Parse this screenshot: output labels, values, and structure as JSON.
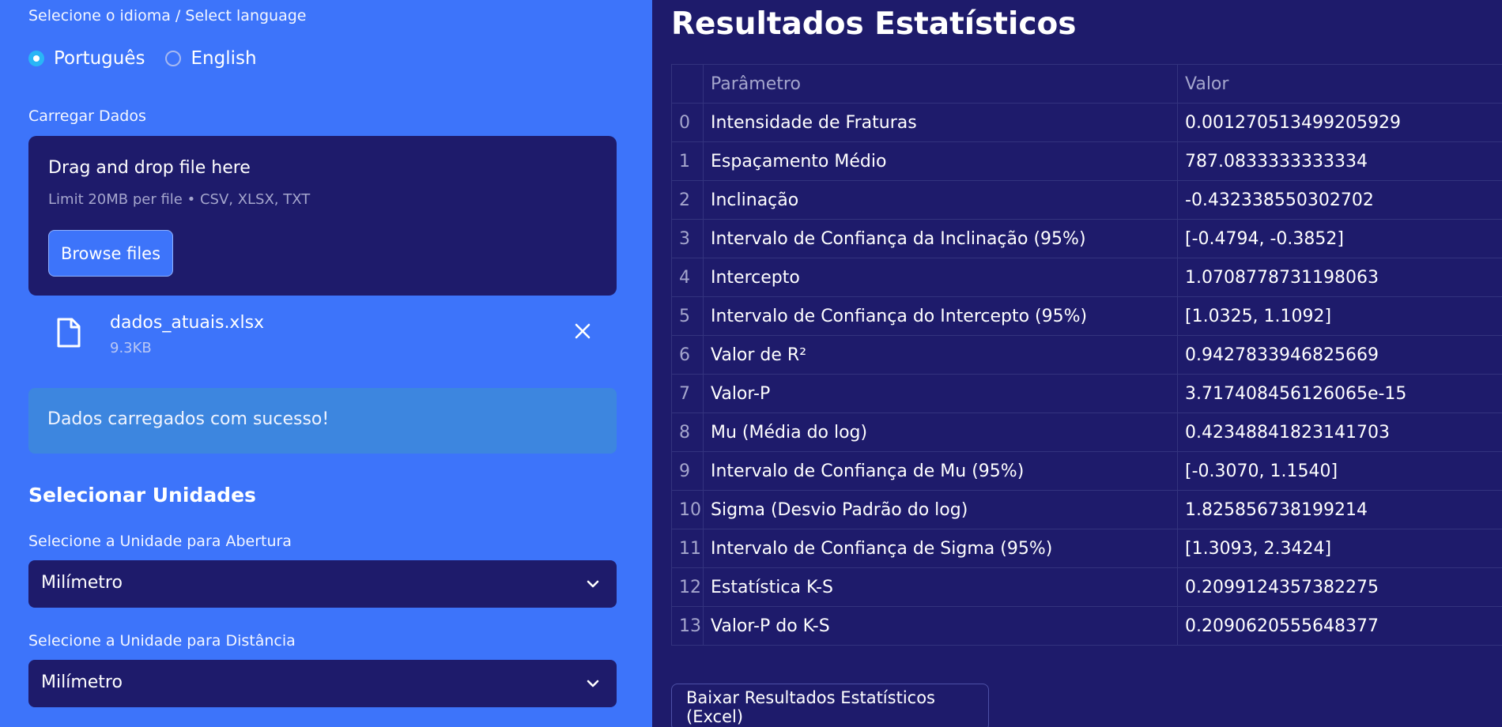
{
  "sidebar": {
    "language_label": "Selecione o idioma / Select language",
    "languages": [
      {
        "label": "Português",
        "selected": true
      },
      {
        "label": "English",
        "selected": false
      }
    ],
    "upload_label": "Carregar Dados",
    "dropzone": {
      "title": "Drag and drop file here",
      "limit": "Limit 20MB per file • CSV, XLSX, TXT",
      "browse_label": "Browse files"
    },
    "uploaded_file": {
      "name": "dados_atuais.xlsx",
      "size": "9.3KB",
      "icon": "file-icon"
    },
    "success_message": "Dados carregados com sucesso!",
    "units_heading": "Selecionar Unidades",
    "aperture_select": {
      "label": "Selecione a Unidade para Abertura",
      "value": "Milímetro"
    },
    "distance_select": {
      "label": "Selecione a Unidade para Distância",
      "value": "Milímetro"
    }
  },
  "main": {
    "title": "Resultados Estatísticos",
    "table": {
      "headers": [
        "",
        "Parâmetro",
        "Valor"
      ],
      "rows": [
        {
          "index": "0",
          "param": "Intensidade de Fraturas",
          "value": "0.001270513499205929"
        },
        {
          "index": "1",
          "param": "Espaçamento Médio",
          "value": "787.0833333333334"
        },
        {
          "index": "2",
          "param": "Inclinação",
          "value": "-0.432338550302702"
        },
        {
          "index": "3",
          "param": "Intervalo de Confiança da Inclinação (95%)",
          "value": "[-0.4794, -0.3852]"
        },
        {
          "index": "4",
          "param": "Intercepto",
          "value": "1.0708778731198063"
        },
        {
          "index": "5",
          "param": "Intervalo de Confiança do Intercepto (95%)",
          "value": "[1.0325, 1.1092]"
        },
        {
          "index": "6",
          "param": "Valor de R²",
          "value": "0.9427833946825669"
        },
        {
          "index": "7",
          "param": "Valor-P",
          "value": "3.717408456126065e-15"
        },
        {
          "index": "8",
          "param": "Mu (Média do log)",
          "value": "0.42348841823141703"
        },
        {
          "index": "9",
          "param": "Intervalo de Confiança de Mu (95%)",
          "value": "[-0.3070, 1.1540]"
        },
        {
          "index": "10",
          "param": "Sigma (Desvio Padrão do log)",
          "value": "1.825856738199214"
        },
        {
          "index": "11",
          "param": "Intervalo de Confiança de Sigma (95%)",
          "value": "[1.3093, 2.3424]"
        },
        {
          "index": "12",
          "param": "Estatística K-S",
          "value": "0.2099124357382275"
        },
        {
          "index": "13",
          "param": "Valor-P do K-S",
          "value": "0.2090620555648377"
        }
      ]
    },
    "download_label": "Baixar Resultados Estatísticos (Excel)"
  },
  "colors": {
    "sidebar_bg": "#3d74fa",
    "main_bg": "#1e1b6b",
    "success_bg": "#3d86df",
    "radio_accent": "#29b6f6"
  }
}
